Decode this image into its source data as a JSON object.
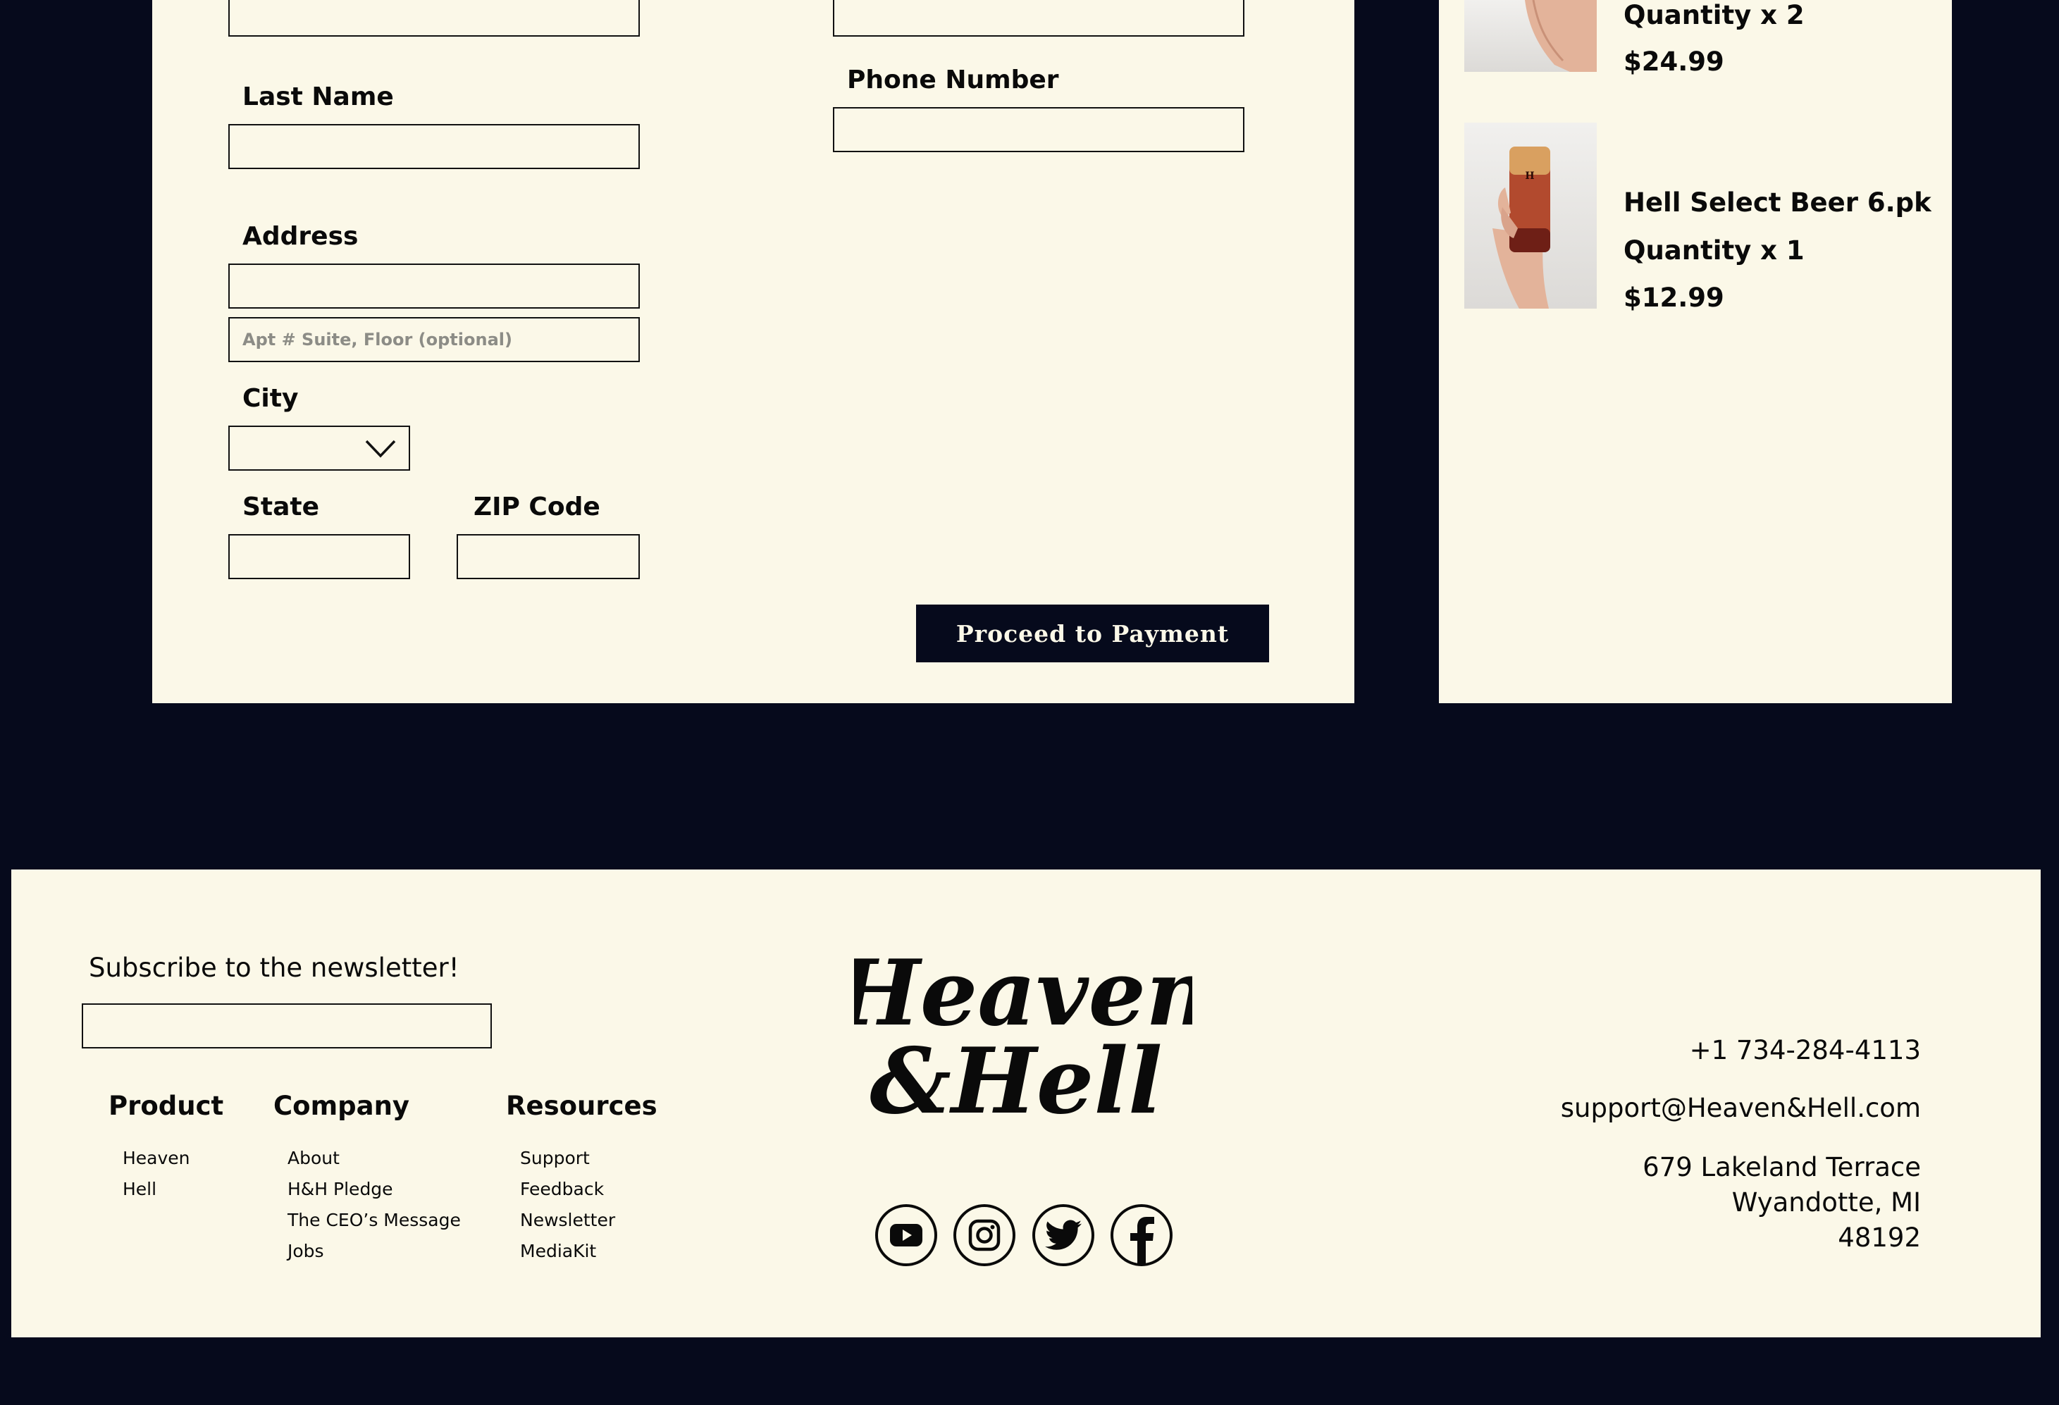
{
  "form": {
    "last_name_label": "Last Name",
    "phone_label": "Phone Number",
    "address_label": "Address",
    "address2_placeholder": "Apt # Suite, Floor (optional)",
    "city_label": "City",
    "state_label": "State",
    "zip_label": "ZIP Code",
    "proceed_button": "Proceed to Payment"
  },
  "cart": {
    "items": [
      {
        "name": "",
        "quantity": "Quantity x 2",
        "price": "$24.99"
      },
      {
        "name": "Hell Select Beer 6.pk",
        "quantity": "Quantity x 1",
        "price": "$12.99"
      }
    ]
  },
  "footer": {
    "newsletter_label": "Subscribe to the newsletter!",
    "columns": [
      {
        "heading": "Product",
        "links": [
          "Heaven",
          "Hell"
        ]
      },
      {
        "heading": "Company",
        "links": [
          "About",
          "H&H Pledge",
          "The CEO’s Message",
          "Jobs"
        ]
      },
      {
        "heading": "Resources",
        "links": [
          "Support",
          "Feedback",
          "Newsletter",
          "MediaKit"
        ]
      }
    ],
    "logo_text": {
      "line1": "Heaven",
      "line2": "&Hell"
    },
    "social_icons": [
      "youtube-icon",
      "instagram-icon",
      "twitter-icon",
      "facebook-icon"
    ],
    "contact": {
      "phone": "+1 734-284-4113",
      "email": "support@Heaven&Hell.com",
      "address_line1": "679 Lakeland Terrace",
      "address_line2": "Wyandotte, MI",
      "address_line3": "48192"
    }
  },
  "colors": {
    "background": "#060a1c",
    "panel": "#fbf8e8",
    "text": "#0a0a0a"
  }
}
